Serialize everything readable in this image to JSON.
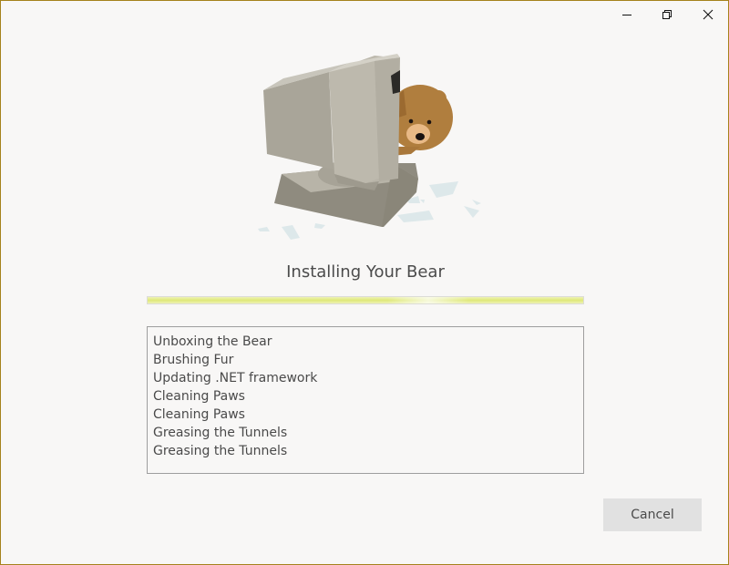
{
  "window": {
    "caption_buttons": [
      {
        "name": "minimize",
        "icon": "minimize-icon"
      },
      {
        "name": "restore",
        "icon": "restore-icon"
      },
      {
        "name": "close",
        "icon": "close-icon"
      }
    ],
    "accent_border_color": "#a5821c"
  },
  "illustration": {
    "subject": "bear-peeking-out-of-computer"
  },
  "installer": {
    "title": "Installing Your Bear",
    "progress_fraction": 1.0,
    "progress_color": "#dfe879",
    "log_items": [
      "Unboxing the Bear",
      "Brushing Fur",
      "Updating .NET framework",
      "Cleaning Paws",
      "Cleaning Paws",
      "Greasing the Tunnels",
      "Greasing the Tunnels"
    ],
    "cancel_label": "Cancel"
  }
}
